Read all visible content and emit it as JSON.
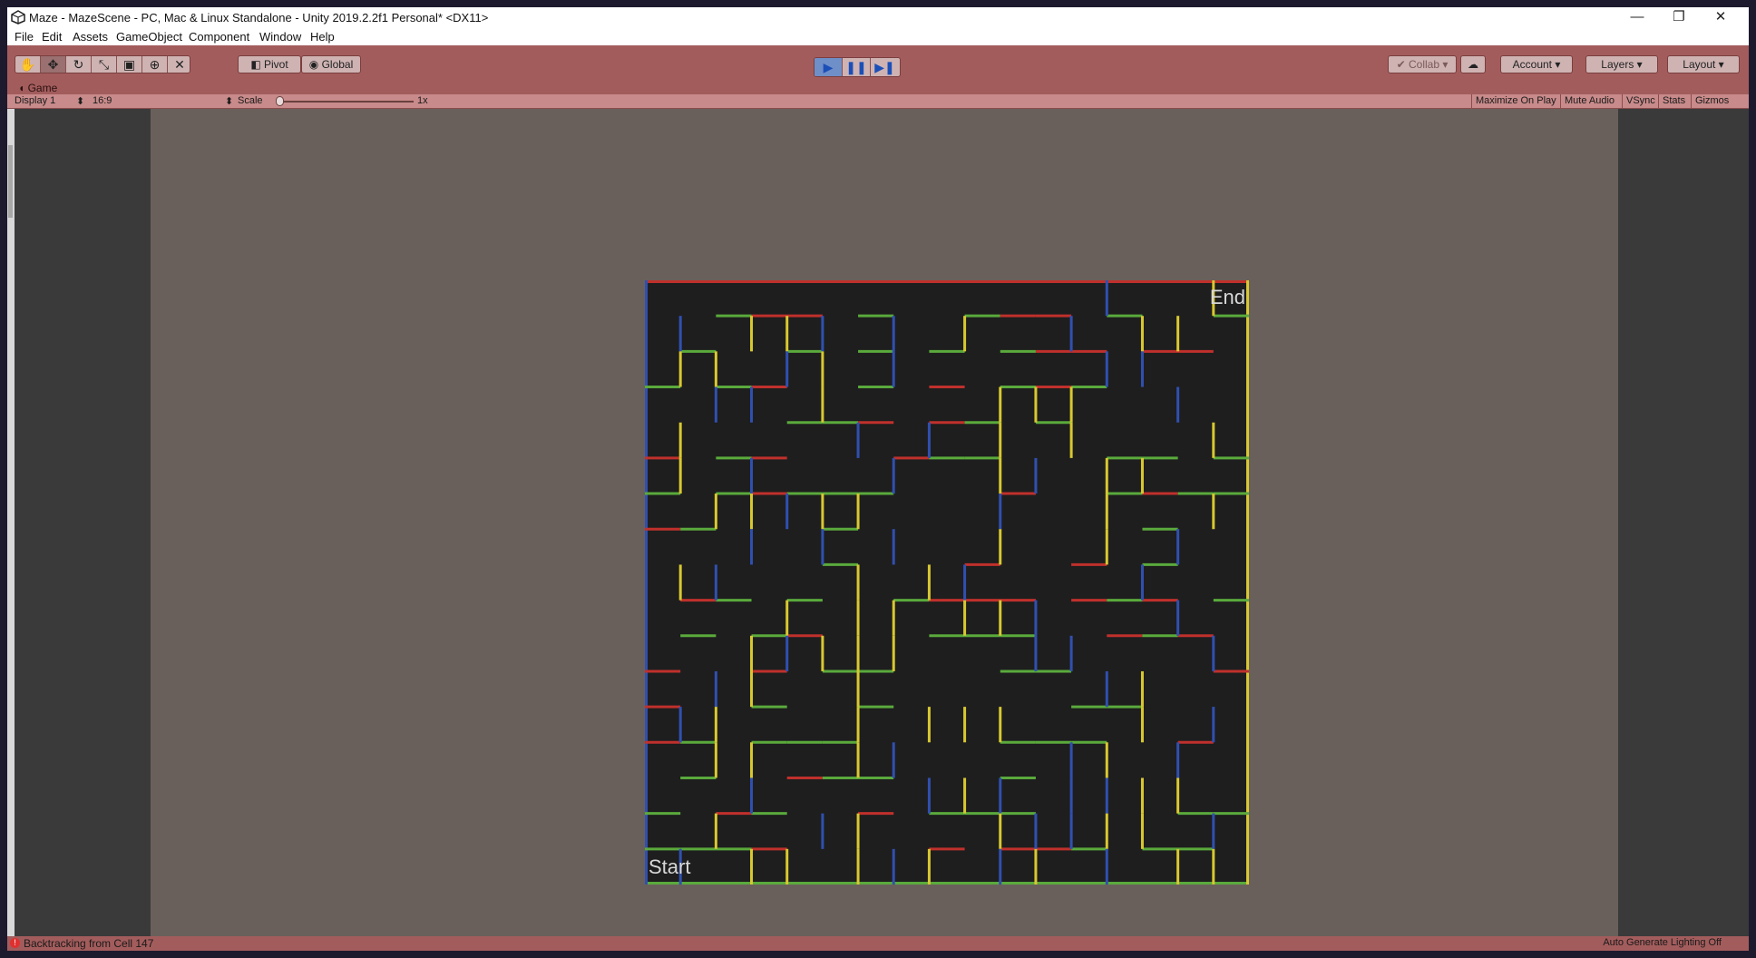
{
  "window": {
    "title": "Maze - MazeScene - PC, Mac & Linux Standalone - Unity 2019.2.2f1 Personal* <DX11>",
    "minimize": "—",
    "restore": "❐",
    "close": "✕"
  },
  "menu": [
    "File",
    "Edit",
    "Assets",
    "GameObject",
    "Component",
    "Window",
    "Help"
  ],
  "toolbar": {
    "tools": [
      "hand-icon",
      "move-icon",
      "rotate-icon",
      "scale-icon",
      "rect-icon",
      "transform-icon",
      "custom-tool-icon"
    ],
    "active_tool": 1,
    "pivot": "Pivot",
    "global": "Global",
    "collab": "Collab",
    "account": "Account",
    "layers": "Layers",
    "layout": "Layout",
    "play_state": "playing"
  },
  "game_tab": {
    "label": "Game",
    "display": "Display 1",
    "aspect": "16:9",
    "scale_label": "Scale",
    "scale_value": "1x",
    "maximize_on_play": "Maximize On Play",
    "mute_audio": "Mute Audio",
    "vsync": "VSync",
    "stats": "Stats",
    "gizmos": "Gizmos"
  },
  "maze": {
    "grid_size": 17,
    "end_label": "End",
    "start_label": "Start"
  },
  "status": {
    "message": "Backtracking from Cell 147",
    "lighting": "Auto Generate Lighting Off"
  },
  "colors": {
    "toolbar": "#a35c5c",
    "game_bg": "#6a605b",
    "maze_floor": "#1e1e1e",
    "wall_red": "#c0302c",
    "wall_green": "#5aaa3c",
    "wall_blue": "#3050b0",
    "wall_yellow": "#d8c830"
  }
}
